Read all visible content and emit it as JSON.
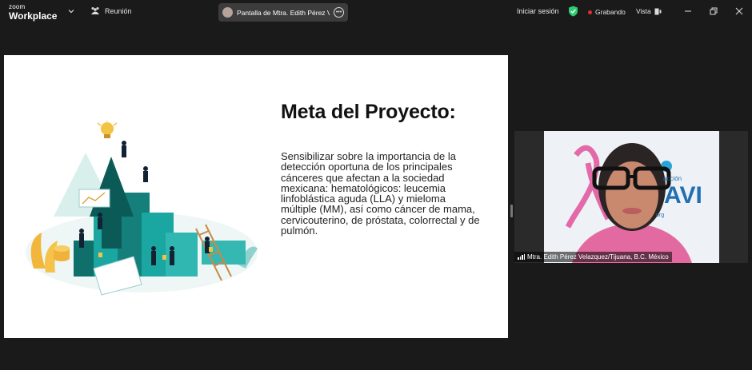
{
  "app": {
    "brand_small": "zoom",
    "brand_large": "Workplace"
  },
  "toolbar": {
    "meeting_label": "Reunión",
    "share_label": "Pantalla de Mtra. Edith Pérez Velá",
    "signin_label": "Iniciar sesión",
    "recording_label": "Grabando",
    "view_label": "Vista"
  },
  "slide": {
    "title": "Meta del Proyecto:",
    "body": "Sensibilizar sobre la importancia de la detección oportuna de los principales cánceres que afectan a la sociedad mexicana: hematológicos: leucemia linfoblástica aguda (LLA) y mieloma múltiple (MM), así como cáncer de mama, cervicouterino, de próstata, colorrectal y de pulmón."
  },
  "participant": {
    "name": "Mtra. Edith Pérez Velazquez/Tijuana, B.C. México",
    "bg_fragment": "acción",
    "bg_fragment2": "org"
  },
  "colors": {
    "accent_green": "#2ecc71",
    "recording_red": "#e02f2f",
    "teal": "#1aa6a1",
    "ribbon_pink": "#e36aa8"
  },
  "icons": [
    "chevron-down-icon",
    "meeting-icon",
    "more-icon",
    "shield-icon",
    "record-dot-icon",
    "view-icon",
    "minimize-icon",
    "restore-icon",
    "close-icon",
    "signal-icon"
  ]
}
